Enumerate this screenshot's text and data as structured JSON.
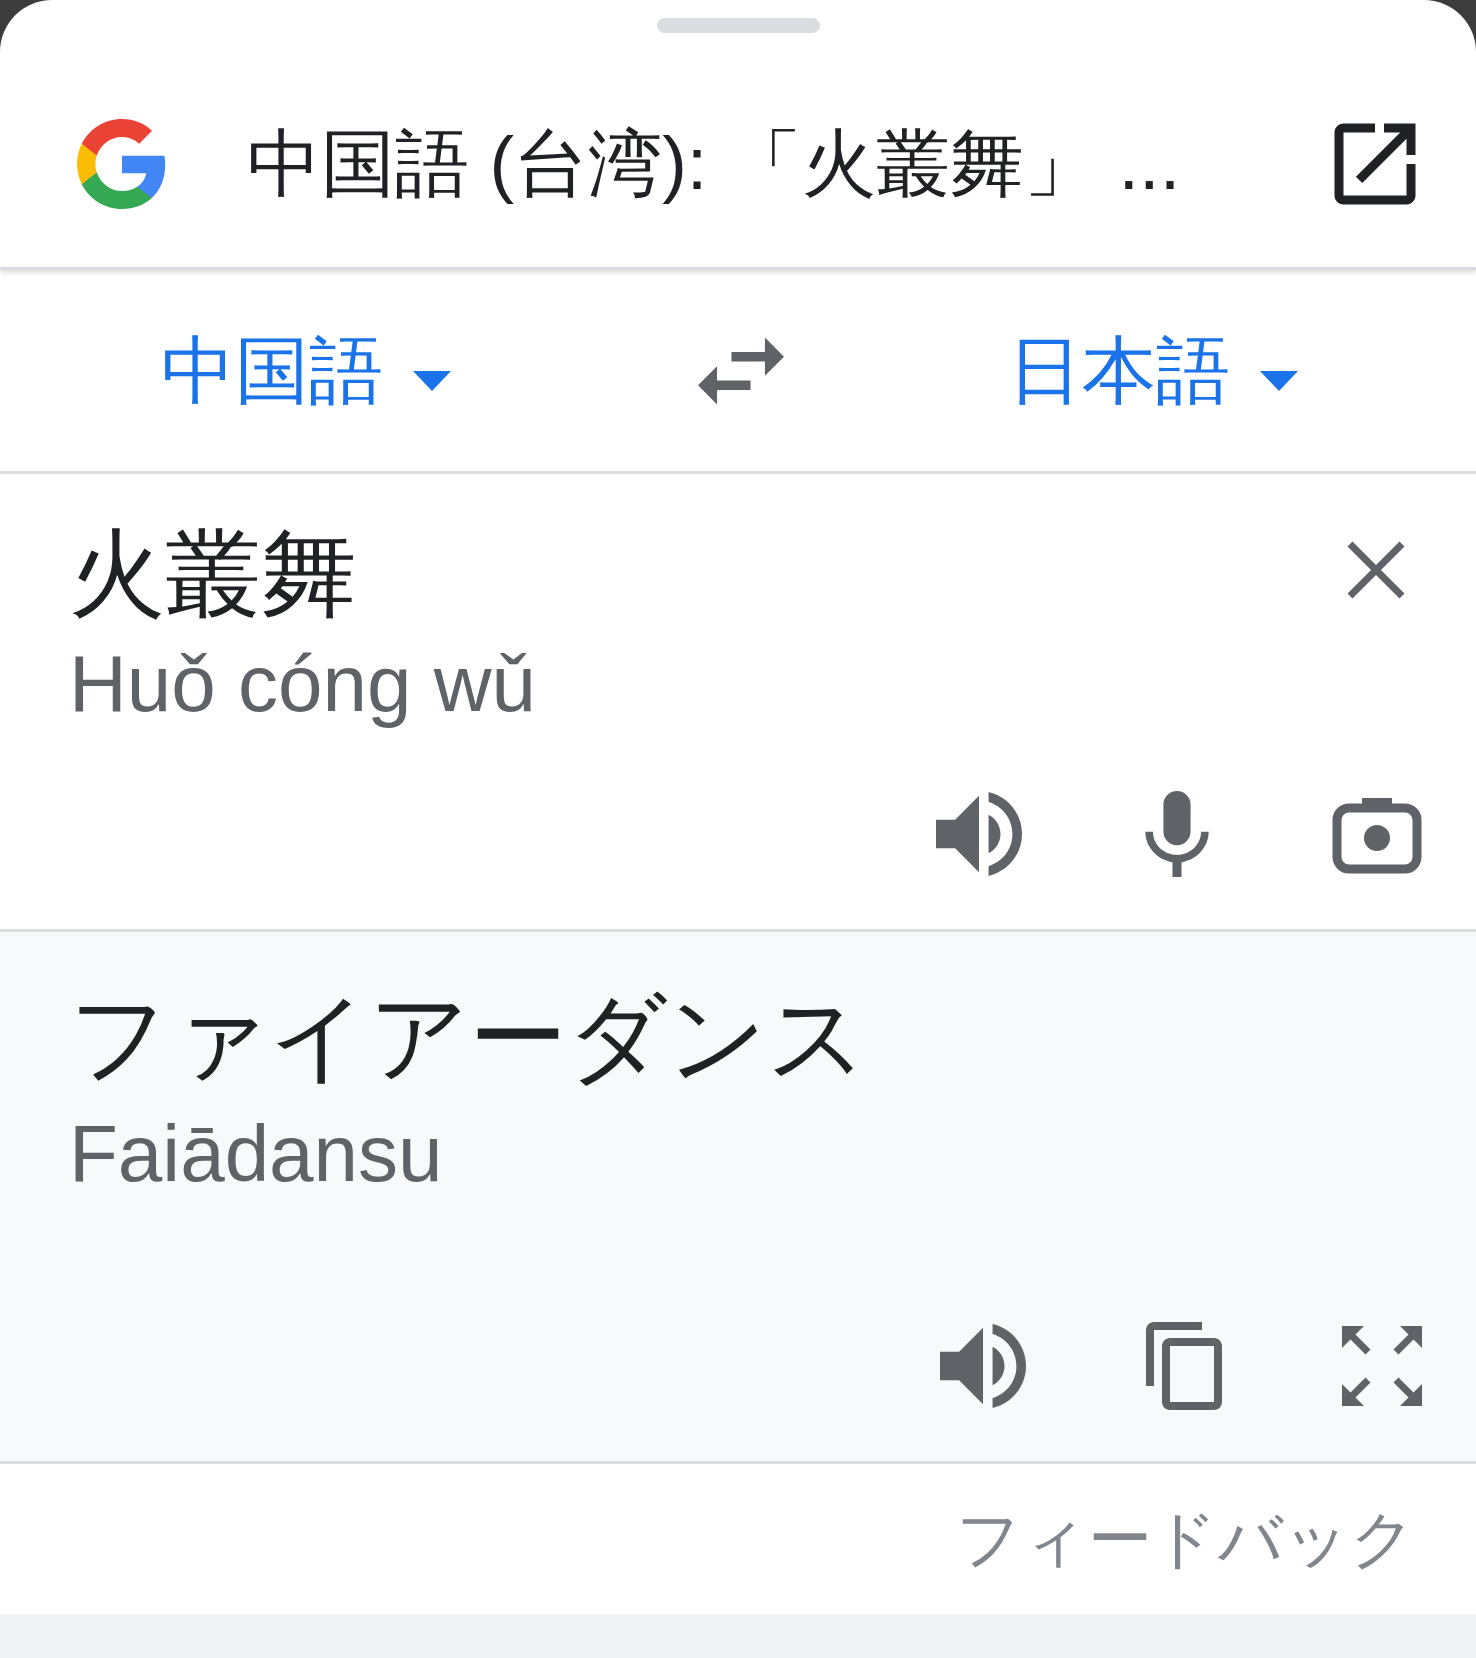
{
  "header": {
    "title": "中国語 (台湾): 「火叢舞」 ..."
  },
  "languages": {
    "source": "中国語",
    "target": "日本語"
  },
  "input": {
    "text": "火叢舞",
    "romanization": "Huǒ cóng wǔ"
  },
  "output": {
    "text": "ファイアーダンス",
    "romanization": "Faiādansu"
  },
  "feedback": "フィードバック"
}
